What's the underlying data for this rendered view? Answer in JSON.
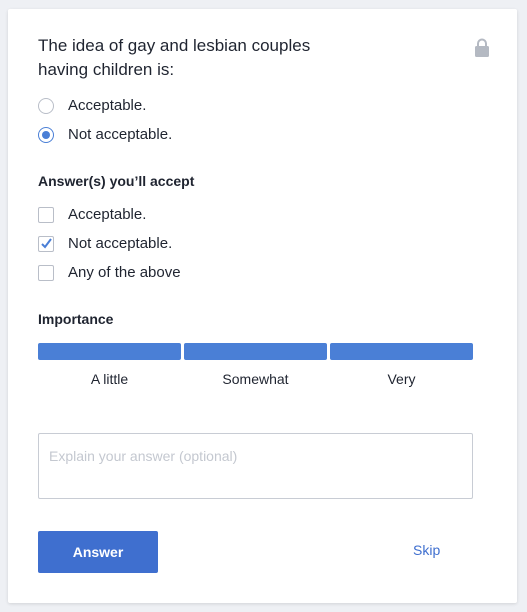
{
  "question": {
    "text": "The idea of gay and lesbian couples having children is:",
    "lock_icon": "lock-icon"
  },
  "my_answer": {
    "options": [
      {
        "label": "Acceptable.",
        "selected": false
      },
      {
        "label": "Not acceptable.",
        "selected": true
      }
    ]
  },
  "accept": {
    "heading": "Answer(s) you’ll accept",
    "options": [
      {
        "label": "Acceptable.",
        "checked": false
      },
      {
        "label": "Not acceptable.",
        "checked": true
      },
      {
        "label": "Any of the above",
        "checked": false
      }
    ]
  },
  "importance": {
    "heading": "Importance",
    "levels": [
      "A little",
      "Somewhat",
      "Very"
    ],
    "selected": "Very"
  },
  "explain": {
    "placeholder": "Explain your answer (optional)",
    "value": ""
  },
  "actions": {
    "answer_label": "Answer",
    "skip_label": "Skip"
  },
  "colors": {
    "accent": "#3f6fcf",
    "bar": "#4a7fd6"
  }
}
